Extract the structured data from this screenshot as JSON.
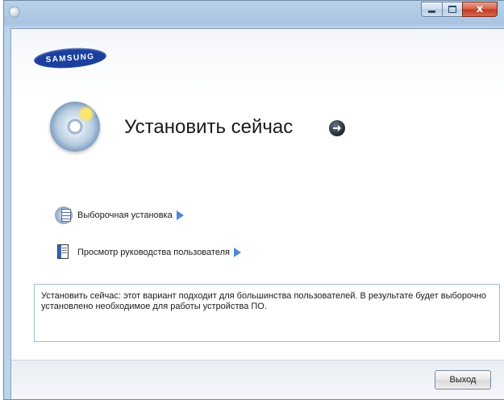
{
  "window": {
    "controls": {
      "minimize": "minimize-icon",
      "maximize": "maximize-icon",
      "close": "close-icon",
      "close_symbol": "x"
    }
  },
  "brand": {
    "logo_text": "SAMSUNG",
    "logo_color": "#1b3f9c"
  },
  "install_now": {
    "title": "Установить сейчас",
    "icon": "install-disc-icon",
    "arrow_icon": "arrow-right-circle-icon"
  },
  "options": [
    {
      "label": "Выборочная установка",
      "icon": "custom-install-icon",
      "arrow_icon": "triangle-right-icon"
    },
    {
      "label": "Просмотр руководства пользователя",
      "icon": "user-manual-icon",
      "arrow_icon": "triangle-right-icon"
    }
  ],
  "description": "Установить сейчас: этот вариант подходит для большинства пользователей. В результате будет выборочно установлено необходимое для работы устройства ПО.",
  "footer": {
    "exit_label": "Выход"
  },
  "colors": {
    "accent_arrow": "#4f86d8",
    "close_button": "#c23c22"
  }
}
